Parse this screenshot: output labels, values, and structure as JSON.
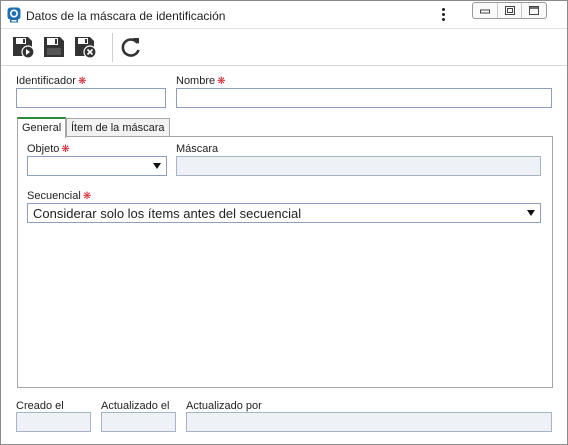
{
  "window": {
    "title": "Datos de la máscara de identificación"
  },
  "toolbar": {
    "buttons": [
      {
        "name": "save-and-new",
        "icon": "save-new-icon"
      },
      {
        "name": "save",
        "icon": "save-icon"
      },
      {
        "name": "save-and-close",
        "icon": "save-close-icon"
      },
      {
        "name": "refresh",
        "icon": "refresh-icon"
      }
    ]
  },
  "form": {
    "identificador_label": "Identificador",
    "identificador_value": "",
    "nombre_label": "Nombre",
    "nombre_value": "",
    "required_marker": "❋"
  },
  "tabs": [
    {
      "label": "General",
      "active": true
    },
    {
      "label": "Ítem de la máscara",
      "active": false
    }
  ],
  "general": {
    "objeto_label": "Objeto",
    "objeto_value": "",
    "mascara_label": "Máscara",
    "mascara_value": "",
    "secuencial_label": "Secuencial",
    "secuencial_value": "Considerar solo los ítems antes del secuencial"
  },
  "footer": {
    "creado_label": "Creado el",
    "creado_value": "",
    "actualizado_label": "Actualizado el",
    "actualizado_value": "",
    "actualizado_por_label": "Actualizado por",
    "actualizado_por_value": ""
  },
  "colors": {
    "active_tab_accent": "#2e8b3a",
    "required_marker": "#d0202a",
    "input_border": "#8e9fbd",
    "readonly_bg": "#eef1f5"
  }
}
